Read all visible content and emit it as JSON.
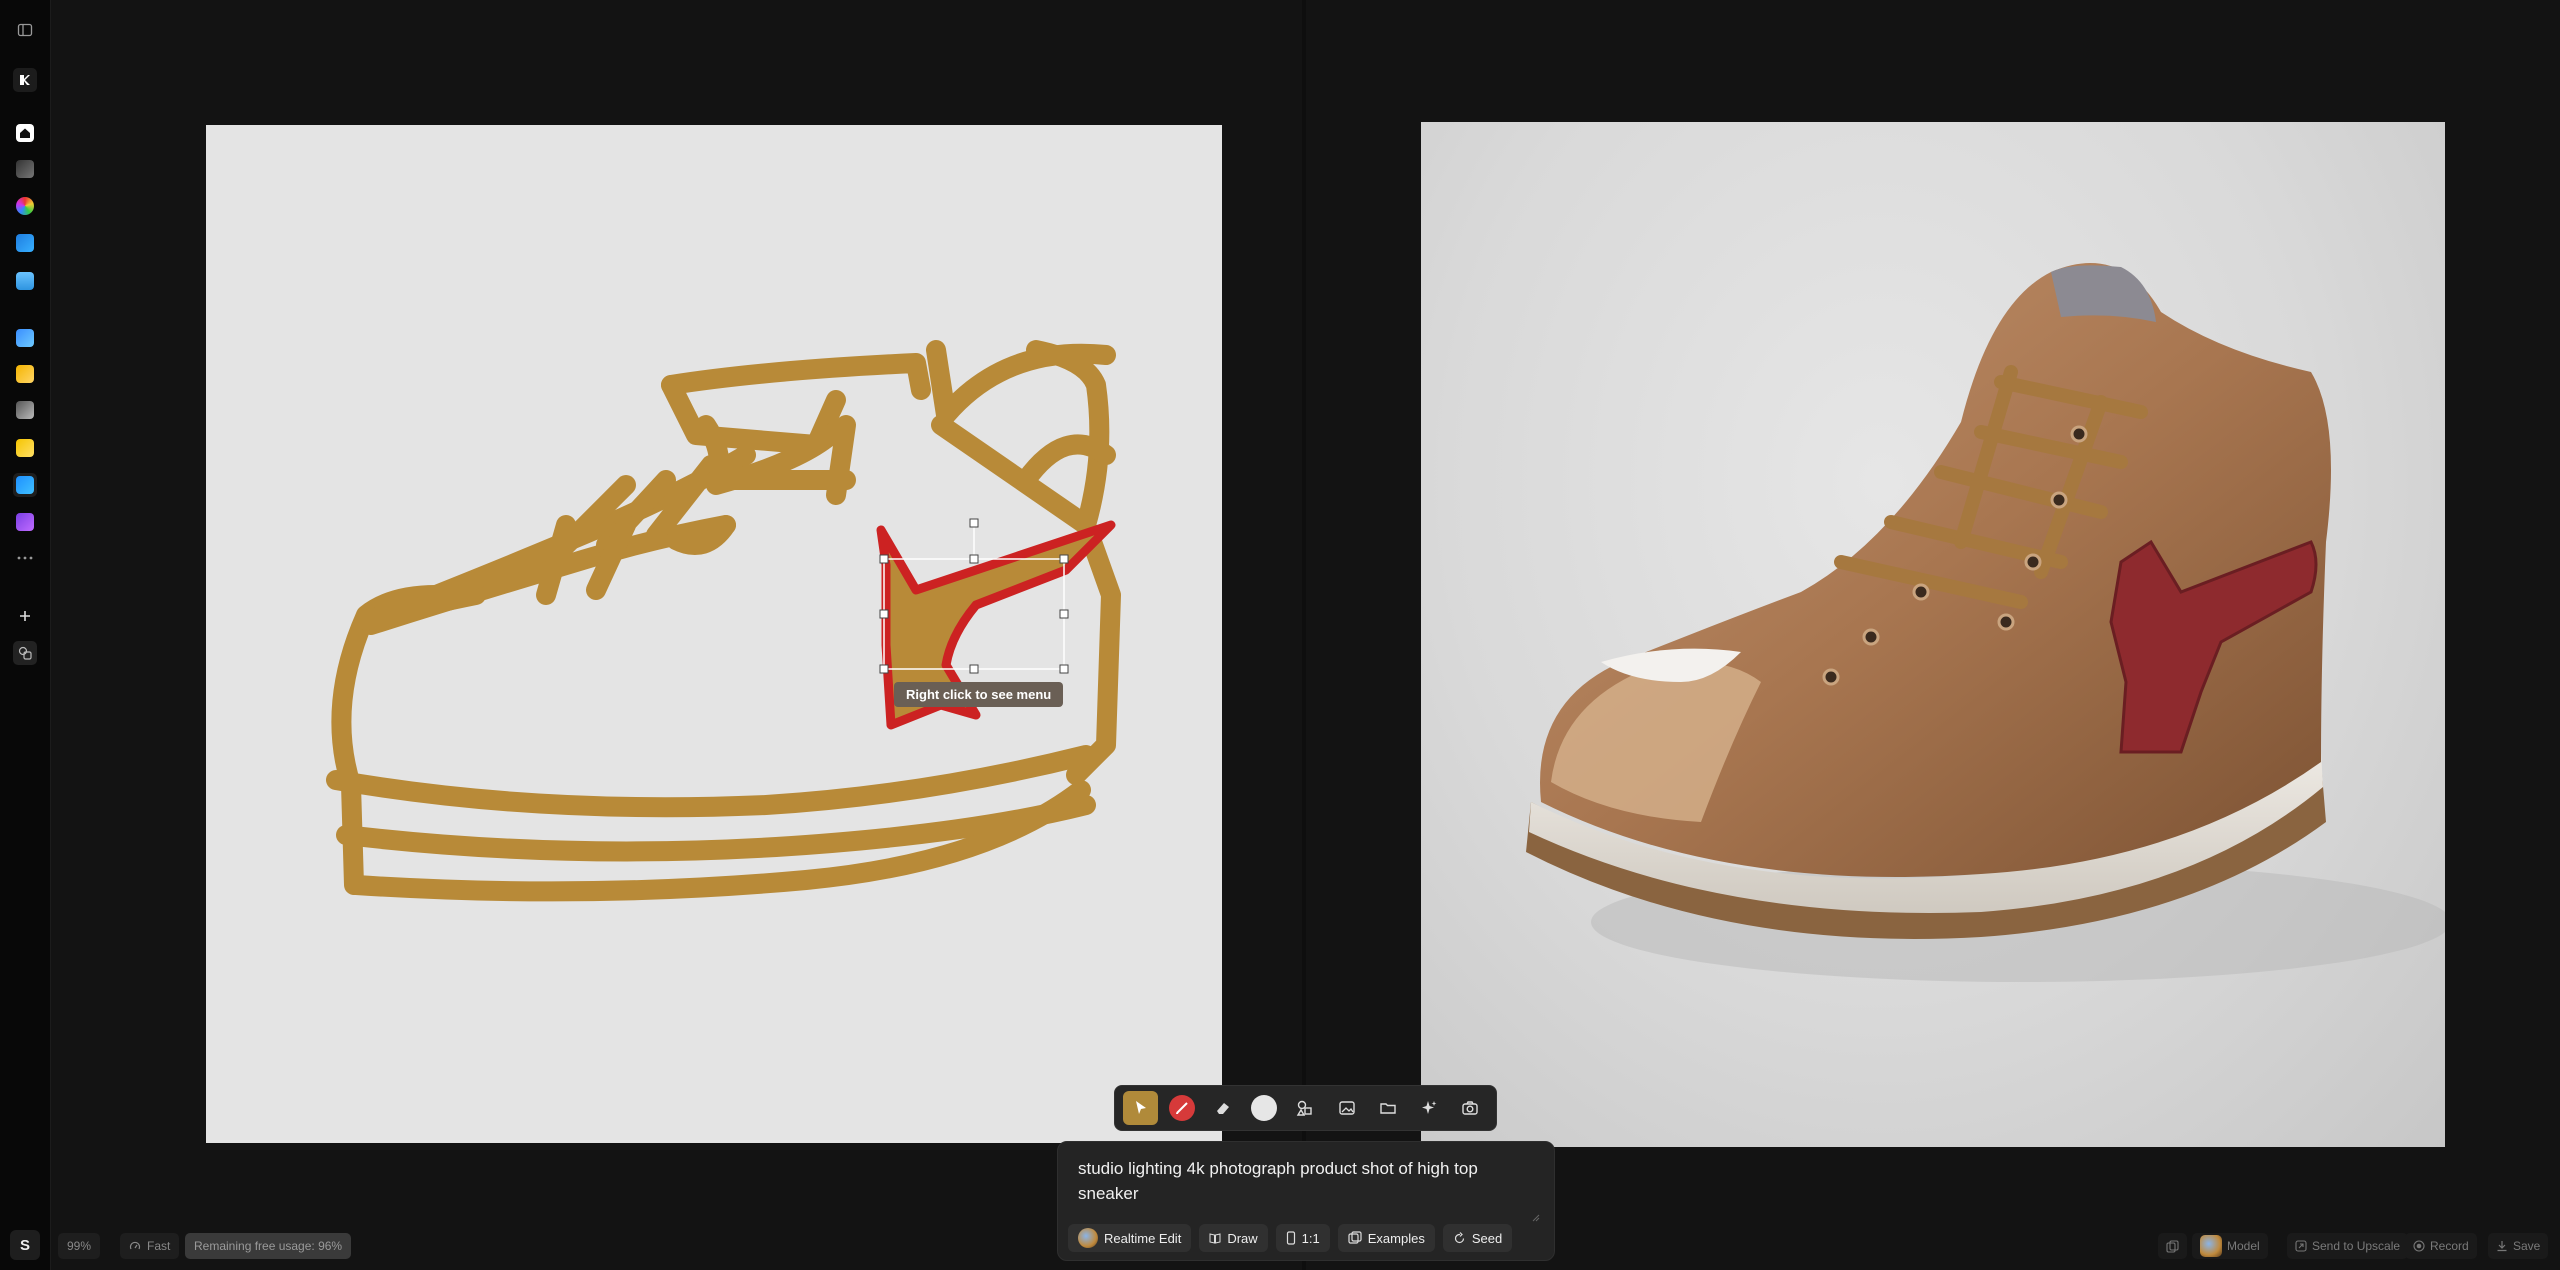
{
  "sidebar": {
    "items": [
      {
        "name": "sidebar-toggle-icon"
      },
      {
        "name": "krea-logo-icon"
      },
      {
        "name": "home-icon"
      },
      {
        "name": "pen-tool-icon"
      },
      {
        "name": "color-wheel-icon"
      },
      {
        "name": "image-grid-icon"
      },
      {
        "name": "folder-icon"
      },
      {
        "name": "video-icon"
      },
      {
        "name": "gallery-icon"
      },
      {
        "name": "brush-icon"
      },
      {
        "name": "enhance-icon"
      },
      {
        "name": "realtime-icon"
      },
      {
        "name": "train-icon"
      },
      {
        "name": "more-icon"
      },
      {
        "name": "add-icon"
      },
      {
        "name": "tools-icon"
      }
    ],
    "avatar_initial": "S"
  },
  "canvas": {
    "tooltip": "Right click to see menu",
    "sketch_color": "#b88a38",
    "accent_color": "#cc2222"
  },
  "toolbar": {
    "tools": [
      {
        "name": "select-tool-icon",
        "active": true
      },
      {
        "name": "brush-tool-icon",
        "active": false
      },
      {
        "name": "eraser-tool-icon",
        "active": false
      },
      {
        "name": "color-swatch",
        "active": false
      },
      {
        "name": "shapes-tool-icon",
        "active": false
      },
      {
        "name": "image-tool-icon",
        "active": false
      },
      {
        "name": "folder-tool-icon",
        "active": false
      },
      {
        "name": "sparkle-tool-icon",
        "active": false
      },
      {
        "name": "camera-tool-icon",
        "active": false
      }
    ]
  },
  "prompt": {
    "text": "studio lighting 4k photograph product shot of high top sneaker",
    "chips": {
      "realtime_edit": "Realtime Edit",
      "draw": "Draw",
      "ratio": "1:1",
      "examples": "Examples",
      "seed": "Seed"
    }
  },
  "status": {
    "zoom": "99%",
    "speed": "Fast",
    "usage": "Remaining free usage: 96%"
  },
  "bottom_right": {
    "model": "Model",
    "upscale": "Send to Upscale",
    "record": "Record",
    "save": "Save"
  }
}
